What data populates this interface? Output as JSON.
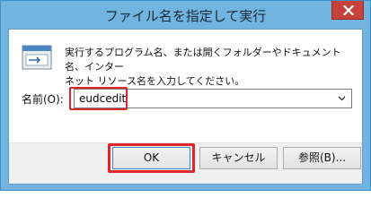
{
  "window": {
    "title": "ファイル名を指定して実行"
  },
  "dialog": {
    "description_line1": "実行するプログラム名、または開くフォルダーやドキュメント名、インター",
    "description_line2": "ネット リソース名を入力してください。",
    "open_label": "名前(O):",
    "open_value": "eudcedit"
  },
  "buttons": {
    "ok": "OK",
    "cancel": "キャンセル",
    "browse": "参照(B)..."
  },
  "icons": {
    "run": "run-dialog-icon",
    "close": "close-icon",
    "dropdown": "chevron-down-icon"
  },
  "colors": {
    "titlebar": "#70b4df",
    "close_button": "#c7423a",
    "highlight": "#e0242b"
  }
}
